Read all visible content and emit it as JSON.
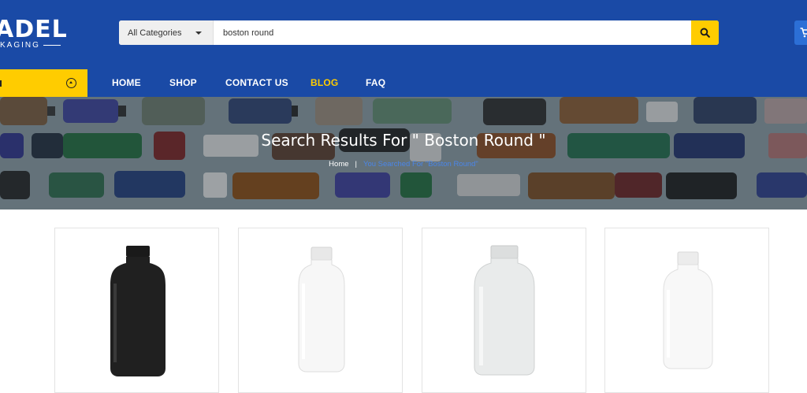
{
  "header": {
    "logo_main": "ADEL",
    "logo_sub": "KAGING",
    "search": {
      "category": "All Categories",
      "query": "boston round"
    }
  },
  "nav": {
    "items": [
      {
        "label": "HOME"
      },
      {
        "label": "SHOP"
      },
      {
        "label": "CONTACT US"
      },
      {
        "label": "BLOG"
      },
      {
        "label": "FAQ"
      }
    ],
    "active": "BLOG"
  },
  "banner": {
    "title": "Search Results For \" Boston Round \"",
    "breadcrumb": {
      "home": "Home",
      "separator": "|",
      "current": "You Searched For \"Boston Round\""
    }
  },
  "products": [
    {
      "name": "black-matte-boston-round-bottle",
      "color": "#1e1e1e"
    },
    {
      "name": "white-boston-round-bottle",
      "color": "#f4f4f4"
    },
    {
      "name": "clear-frosted-boston-round-bottle",
      "color": "#e6e8e8"
    },
    {
      "name": "white-boston-round-bottle-small",
      "color": "#f6f6f6"
    }
  ],
  "colors": {
    "brand_blue": "#1a4aa6",
    "accent_yellow": "#ffcc00",
    "breadcrumb_link": "#4a86e8"
  }
}
